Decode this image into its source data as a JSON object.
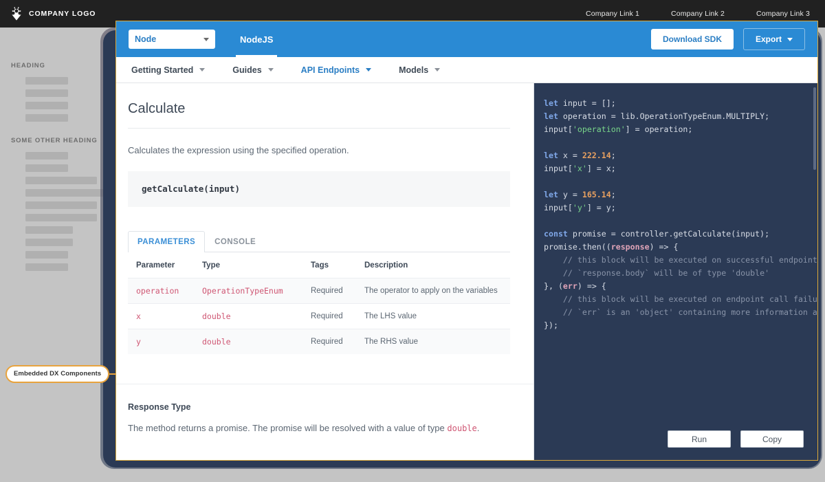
{
  "host": {
    "logo_text": "COMPANY LOGO",
    "logo_icon": "flower-gear-icon",
    "links": [
      "Company Link 1",
      "Company Link 2",
      "Company Link 3"
    ],
    "sidebar": {
      "heading_1": "HEADING",
      "heading_2": "SOME OTHER HEADING",
      "group_1_bar_widths": [
        62,
        62,
        62,
        62
      ],
      "group_2_bar_widths": [
        62,
        62,
        104,
        140,
        104,
        104,
        69,
        69,
        62,
        62
      ]
    },
    "callout": {
      "label": "Embedded DX Components",
      "accent": "#e8a33d"
    }
  },
  "widget": {
    "header": {
      "language_select": {
        "value": "Node",
        "icon": "chevron-down-icon"
      },
      "sdk_tab": "NodeJS",
      "download_button": "Download SDK",
      "export_button": "Export",
      "export_icon": "chevron-down-icon",
      "accent": "#2a8ad4"
    },
    "nav": [
      {
        "label": "Getting Started",
        "active": false
      },
      {
        "label": "Guides",
        "active": false
      },
      {
        "label": "API Endpoints",
        "active": true
      },
      {
        "label": "Models",
        "active": false
      }
    ],
    "doc": {
      "title": "Calculate",
      "description": "Calculates the expression using the specified operation.",
      "signature": "getCalculate(input)",
      "tabs": [
        {
          "label": "PARAMETERS",
          "active": true
        },
        {
          "label": "CONSOLE",
          "active": false
        }
      ],
      "table": {
        "headers": [
          "Parameter",
          "Type",
          "Tags",
          "Description"
        ],
        "rows": [
          [
            "operation",
            "OperationTypeEnum",
            "Required",
            "The operator to apply on the variables"
          ],
          [
            "x",
            "double",
            "Required",
            "The LHS value"
          ],
          [
            "y",
            "double",
            "Required",
            "The RHS value"
          ]
        ]
      },
      "response": {
        "title": "Response Type",
        "text_before": "The method returns a promise. The promise will be resolved with a value of type",
        "type": "double",
        "text_after": "."
      }
    },
    "code": {
      "language": "JavaScript",
      "run_button": "Run",
      "copy_button": "Copy",
      "background": "#2b3a55",
      "lines": [
        [
          {
            "t": "let ",
            "c": "k"
          },
          {
            "t": "input = [];",
            "c": "v"
          }
        ],
        [
          {
            "t": "let ",
            "c": "k"
          },
          {
            "t": "operation = lib.OperationTypeEnum.MULTIPLY;",
            "c": "v"
          }
        ],
        [
          {
            "t": "input[",
            "c": "v"
          },
          {
            "t": "'operation'",
            "c": "s"
          },
          {
            "t": "] = operation;",
            "c": "v"
          }
        ],
        [],
        [
          {
            "t": "let ",
            "c": "k"
          },
          {
            "t": "x = ",
            "c": "v"
          },
          {
            "t": "222.14",
            "c": "n"
          },
          {
            "t": ";",
            "c": "v"
          }
        ],
        [
          {
            "t": "input[",
            "c": "v"
          },
          {
            "t": "'x'",
            "c": "s"
          },
          {
            "t": "] = x;",
            "c": "v"
          }
        ],
        [],
        [
          {
            "t": "let ",
            "c": "k"
          },
          {
            "t": "y = ",
            "c": "v"
          },
          {
            "t": "165.14",
            "c": "n"
          },
          {
            "t": ";",
            "c": "v"
          }
        ],
        [
          {
            "t": "input[",
            "c": "v"
          },
          {
            "t": "'y'",
            "c": "s"
          },
          {
            "t": "] = y;",
            "c": "v"
          }
        ],
        [],
        [
          {
            "t": "const ",
            "c": "k"
          },
          {
            "t": "promise = controller.getCalculate(input);",
            "c": "v"
          }
        ],
        [
          {
            "t": "promise.then((",
            "c": "v"
          },
          {
            "t": "response",
            "c": "p"
          },
          {
            "t": ") => {",
            "c": "v"
          }
        ],
        [
          {
            "t": "    // this block will be executed on successful endpoint call",
            "c": "c"
          }
        ],
        [
          {
            "t": "    // `response.body` will be of type 'double'",
            "c": "c"
          }
        ],
        [
          {
            "t": "}, (",
            "c": "v"
          },
          {
            "t": "err",
            "c": "p"
          },
          {
            "t": ") => {",
            "c": "v"
          }
        ],
        [
          {
            "t": "    // this block will be executed on endpoint call failure",
            "c": "c"
          }
        ],
        [
          {
            "t": "    // `err` is an 'object' containing more information about the error",
            "c": "c"
          }
        ],
        [
          {
            "t": "});",
            "c": "v"
          }
        ]
      ]
    }
  }
}
